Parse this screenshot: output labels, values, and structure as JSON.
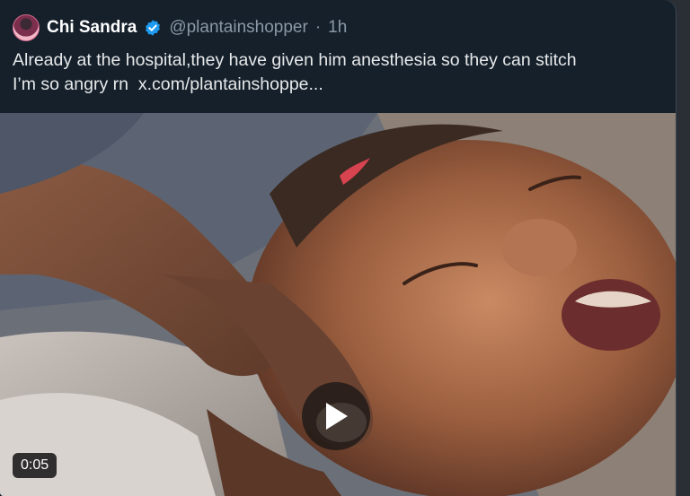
{
  "tweet": {
    "author_name": "Chi Sandra",
    "handle": "@plantainshopper",
    "separator": "·",
    "time": "1h",
    "text_line1": "Already at the hospital,they have given him anesthesia so they can stitch",
    "text_line2_prefix": "I’m so angry rn",
    "link_text": "x.com/plantainshoppe..."
  },
  "media": {
    "duration": "0:05",
    "play_icon": "play-icon"
  },
  "colors": {
    "background": "#15202b",
    "verified": "#1d9bf0",
    "handle": "#8b98a5",
    "text": "#e7e9ea"
  }
}
